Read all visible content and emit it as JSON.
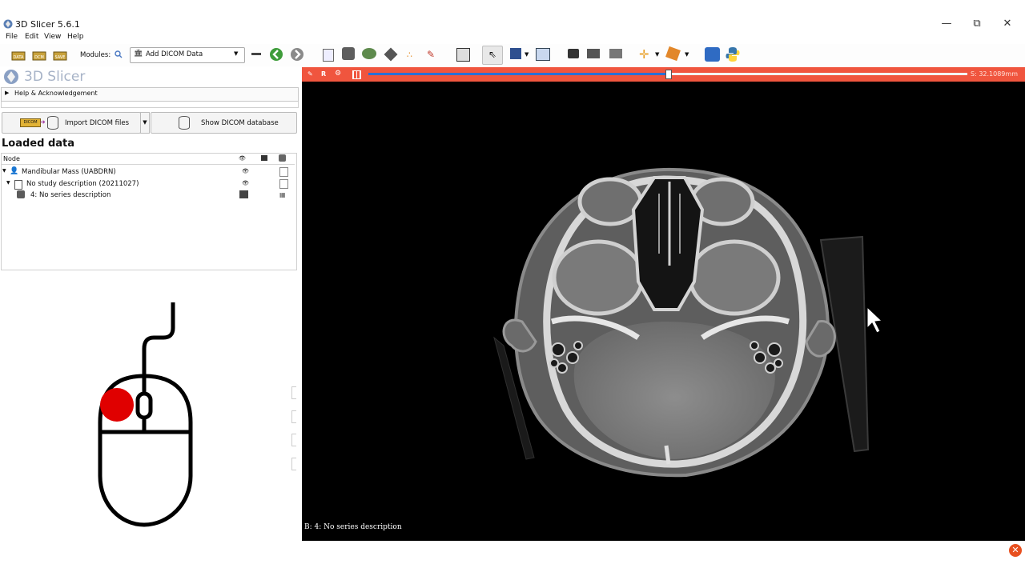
{
  "window": {
    "title": "3D Slicer 5.6.1",
    "controls": {
      "minimize": "—",
      "restore": "⧉",
      "close": "✕"
    }
  },
  "menu": [
    "File",
    "Edit",
    "View",
    "Help"
  ],
  "toolbar": {
    "modules_label": "Modules:",
    "module_selected": "Add DICOM Data",
    "load_data_icons": [
      "DATA",
      "DCM",
      "SAVE"
    ]
  },
  "left_panel": {
    "logo_text": "3D Slicer",
    "help_section": "Help & Acknowledgement",
    "import_button": "Import DICOM files",
    "show_db_button": "Show DICOM database",
    "loaded_title": "Loaded data",
    "tree_header": "Node",
    "tree_rows": [
      {
        "label": "Mandibular Mass (UABDRN)",
        "level": 0
      },
      {
        "label": "No study description (20211027)",
        "level": 1
      },
      {
        "label": "4: No series description",
        "level": 2
      }
    ]
  },
  "slice_view": {
    "orientation": "R",
    "offset": "S: 32.1089mm",
    "slider_fraction": 0.5,
    "volume_label": "B: 4: No series description"
  },
  "colors": {
    "slice_bar": "#f0553e",
    "slider_fill": "#2a6fd6",
    "viewer_bg": "#000000"
  },
  "icons": {
    "app": "slicer-logo-icon",
    "mouse": "mouse-left-click-icon"
  }
}
